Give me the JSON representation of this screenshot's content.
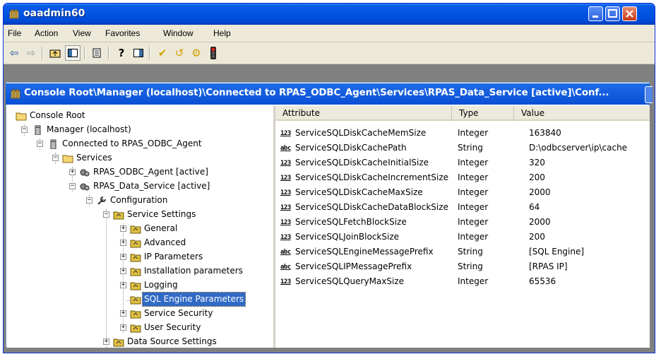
{
  "window": {
    "title": "oaadmin60"
  },
  "menu": [
    "File",
    "Action",
    "View",
    "Favorites",
    "Window",
    "Help"
  ],
  "toolbar_icons": [
    "back-arrow-icon",
    "forward-arrow-icon",
    "up-folder-icon",
    "show-hide-tree-icon",
    "export-list-icon",
    "help-icon",
    "properties-pane-icon",
    "check-icon",
    "reload-icon",
    "settings-gear-icon",
    "traffic-light-icon"
  ],
  "mdi": {
    "title": "Console Root\\Manager (localhost)\\Connected to RPAS_ODBC_Agent\\Services\\RPAS_Data_Service [active]\\Conf..."
  },
  "tree": [
    {
      "label": "Console Root"
    },
    {
      "label": "Manager (localhost)"
    },
    {
      "label": "Connected to RPAS_ODBC_Agent"
    },
    {
      "label": "Services"
    },
    {
      "label": "RPAS_ODBC_Agent [active]"
    },
    {
      "label": "RPAS_Data_Service [active]"
    },
    {
      "label": "Configuration"
    },
    {
      "label": "Service Settings"
    },
    {
      "label": "General"
    },
    {
      "label": "Advanced"
    },
    {
      "label": "IP Parameters"
    },
    {
      "label": "Installation parameters"
    },
    {
      "label": "Logging"
    },
    {
      "label": "SQL Engine Parameters"
    },
    {
      "label": "Service Security"
    },
    {
      "label": "User Security"
    },
    {
      "label": "Data Source Settings"
    }
  ],
  "list": {
    "columns": [
      "Attribute",
      "Type",
      "Value"
    ],
    "rows": [
      {
        "icon": "123",
        "attribute": "ServiceSQLDiskCacheMemSize",
        "type": "Integer",
        "value": "163840"
      },
      {
        "icon": "abc",
        "attribute": "ServiceSQLDiskCachePath",
        "type": "String",
        "value": "D:\\odbcserver\\ip\\cache"
      },
      {
        "icon": "123",
        "attribute": "ServiceSQLDiskCacheInitialSize",
        "type": "Integer",
        "value": "320"
      },
      {
        "icon": "123",
        "attribute": "ServiceSQLDiskCacheIncrementSize",
        "type": "Integer",
        "value": "200"
      },
      {
        "icon": "123",
        "attribute": "ServiceSQLDiskCacheMaxSize",
        "type": "Integer",
        "value": "2000"
      },
      {
        "icon": "123",
        "attribute": "ServiceSQLDiskCacheDataBlockSize",
        "type": "Integer",
        "value": "64"
      },
      {
        "icon": "123",
        "attribute": "ServiceSQLFetchBlockSize",
        "type": "Integer",
        "value": "2000"
      },
      {
        "icon": "123",
        "attribute": "ServiceSQLJoinBlockSize",
        "type": "Integer",
        "value": "200"
      },
      {
        "icon": "abc",
        "attribute": "ServiceSQLEngineMessagePrefix",
        "type": "String",
        "value": "[SQL Engine]"
      },
      {
        "icon": "abc",
        "attribute": "ServiceSQLIPMessagePrefix",
        "type": "String",
        "value": "[RPAS IP]"
      },
      {
        "icon": "123",
        "attribute": "ServiceSQLQueryMaxSize",
        "type": "Integer",
        "value": "65536"
      }
    ]
  },
  "colors": {
    "titlebar": "#0054e3",
    "selection": "#316ac5",
    "window_bg": "#ECE9D8"
  }
}
